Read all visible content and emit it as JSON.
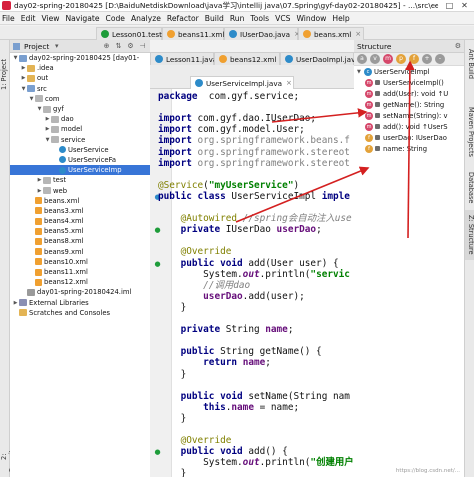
{
  "window": {
    "title": "day02-spring-20180425 [D:\\BaiduNetdiskDownload\\java学习\\intellij java\\07.Spring\\gyf-day02-20180425] - ...\\src\\com\\gyf\\service\\UserServiceImpl.java [day02-spring-20180425] - IntelliJ IDEA",
    "minimize": "—",
    "maximize": "□",
    "close": "✕"
  },
  "menu": [
    "File",
    "Edit",
    "View",
    "Navigate",
    "Code",
    "Analyze",
    "Refactor",
    "Build",
    "Run",
    "Tools",
    "VCS",
    "Window",
    "Help"
  ],
  "project_panel": {
    "label": "Project",
    "tree": [
      {
        "label": "day02-spring-20180425 [day01-",
        "indent": 0,
        "icon": "folder-blue",
        "arrow": "▼"
      },
      {
        "label": ".idea",
        "indent": 1,
        "icon": "folder",
        "arrow": "▶"
      },
      {
        "label": "out",
        "indent": 1,
        "icon": "folder",
        "arrow": "▶"
      },
      {
        "label": "src",
        "indent": 1,
        "icon": "folder-blue",
        "arrow": "▼"
      },
      {
        "label": "com",
        "indent": 2,
        "icon": "package",
        "arrow": "▼"
      },
      {
        "label": "gyf",
        "indent": 3,
        "icon": "package",
        "arrow": "▼"
      },
      {
        "label": "dao",
        "indent": 4,
        "icon": "package",
        "arrow": "▶"
      },
      {
        "label": "model",
        "indent": 4,
        "icon": "package",
        "arrow": "▶"
      },
      {
        "label": "service",
        "indent": 4,
        "icon": "package",
        "arrow": "▼"
      },
      {
        "label": "UserService",
        "indent": 5,
        "icon": "class",
        "arrow": ""
      },
      {
        "label": "UserServiceFa",
        "indent": 5,
        "icon": "class",
        "arrow": ""
      },
      {
        "label": "UserServiceImp",
        "indent": 5,
        "icon": "class",
        "arrow": "",
        "selected": true
      },
      {
        "label": "test",
        "indent": 3,
        "icon": "package",
        "arrow": "▶"
      },
      {
        "label": "web",
        "indent": 3,
        "icon": "package",
        "arrow": "▶"
      },
      {
        "label": "beans.xml",
        "indent": 2,
        "icon": "xml",
        "arrow": ""
      },
      {
        "label": "beans3.xml",
        "indent": 2,
        "icon": "xml",
        "arrow": ""
      },
      {
        "label": "beans4.xml",
        "indent": 2,
        "icon": "xml",
        "arrow": ""
      },
      {
        "label": "beans5.xml",
        "indent": 2,
        "icon": "xml",
        "arrow": ""
      },
      {
        "label": "beans8.xml",
        "indent": 2,
        "icon": "xml",
        "arrow": ""
      },
      {
        "label": "beans9.xml",
        "indent": 2,
        "icon": "xml",
        "arrow": ""
      },
      {
        "label": "beans10.xml",
        "indent": 2,
        "icon": "xml",
        "arrow": ""
      },
      {
        "label": "beans11.xml",
        "indent": 2,
        "icon": "xml",
        "arrow": ""
      },
      {
        "label": "beans12.xml",
        "indent": 2,
        "icon": "xml",
        "arrow": ""
      },
      {
        "label": "day01-spring-20180424.iml",
        "indent": 1,
        "icon": "iml",
        "arrow": ""
      },
      {
        "label": "External Libraries",
        "indent": 0,
        "icon": "lib",
        "arrow": "▶"
      },
      {
        "label": "Scratches and Consoles",
        "indent": 0,
        "icon": "folder",
        "arrow": ""
      }
    ]
  },
  "left_strip": {
    "project_tab": "1: Project",
    "favorites_tab": "2: Favorites"
  },
  "editor_tabs_row1": [
    {
      "label": "Lesson01.test1",
      "active": false
    },
    {
      "label": "beans11.xml",
      "active": false
    },
    {
      "label": "IUserDao.java",
      "active": false
    },
    {
      "label": "beans.xml",
      "active": false
    }
  ],
  "editor_tabs_row2": [
    {
      "label": "Lesson11.java",
      "active": false
    },
    {
      "label": "beans12.xml",
      "active": false
    },
    {
      "label": "UserDaoImpl.java",
      "active": false
    },
    {
      "label": "User.java",
      "active": false
    }
  ],
  "editor_tabs_row3": [
    {
      "label": "UserServiceImpl.java",
      "active": true
    }
  ],
  "code_lines": [
    [
      [
        "kw",
        "package"
      ],
      [
        "",
        "  com.gyf.service;"
      ]
    ],
    [
      [
        "",
        ""
      ]
    ],
    [
      [
        "kw",
        "import"
      ],
      [
        "",
        " com.gyf.dao.IUserDao;"
      ]
    ],
    [
      [
        "kw",
        "import"
      ],
      [
        "",
        " com.gyf.model.User;"
      ]
    ],
    [
      [
        "kw",
        "import"
      ],
      [
        "gray",
        " org.springframework.beans.f"
      ]
    ],
    [
      [
        "kw",
        "import"
      ],
      [
        "gray",
        " org.springframework.stereot"
      ]
    ],
    [
      [
        "kw",
        "import"
      ],
      [
        "gray",
        " org.springframework.stereot"
      ]
    ],
    [
      [
        "",
        ""
      ]
    ],
    [
      [
        "ann",
        "@Service"
      ],
      [
        "",
        "("
      ],
      [
        "str",
        "\"myUserService\""
      ],
      [
        "",
        ")"
      ]
    ],
    [
      [
        "kw",
        "public class"
      ],
      [
        "",
        " UserServiceImpl "
      ],
      [
        "kw",
        "imple"
      ]
    ],
    [
      [
        "",
        ""
      ]
    ],
    [
      [
        "ann",
        "    @Autowired"
      ],
      [
        "cmt",
        " //spring会自动注入use"
      ]
    ],
    [
      [
        "kw",
        "    private"
      ],
      [
        "",
        " IUserDao "
      ],
      [
        "fld",
        "userDao"
      ],
      [
        "",
        ";"
      ]
    ],
    [
      [
        "",
        ""
      ]
    ],
    [
      [
        "ann",
        "    @Override"
      ]
    ],
    [
      [
        "kw",
        "    public void"
      ],
      [
        "",
        " add(User user) {"
      ]
    ],
    [
      [
        "",
        "        System."
      ],
      [
        "static-out",
        "out"
      ],
      [
        "",
        ".println("
      ],
      [
        "str",
        "\"servic"
      ]
    ],
    [
      [
        "cmt",
        "        //调用dao"
      ]
    ],
    [
      [
        "fld",
        "        userDao"
      ],
      [
        "",
        ".add(user);"
      ]
    ],
    [
      [
        "",
        "    }"
      ]
    ],
    [
      [
        "",
        ""
      ]
    ],
    [
      [
        "kw",
        "    private"
      ],
      [
        "",
        " String "
      ],
      [
        "fld",
        "name"
      ],
      [
        "",
        ";"
      ]
    ],
    [
      [
        "",
        ""
      ]
    ],
    [
      [
        "kw",
        "    public"
      ],
      [
        "",
        " String getName() {"
      ]
    ],
    [
      [
        "kw",
        "        return"
      ],
      [
        "",
        " "
      ],
      [
        "fld",
        "name"
      ],
      [
        "",
        ";"
      ]
    ],
    [
      [
        "",
        "    }"
      ]
    ],
    [
      [
        "",
        ""
      ]
    ],
    [
      [
        "kw",
        "    public void"
      ],
      [
        "",
        " setName(String nam"
      ]
    ],
    [
      [
        "kw",
        "        this"
      ],
      [
        "",
        "."
      ],
      [
        "fld",
        "name"
      ],
      [
        "",
        " = "
      ],
      [
        "",
        "name;"
      ]
    ],
    [
      [
        "",
        "    }"
      ]
    ],
    [
      [
        "",
        ""
      ]
    ],
    [
      [
        "ann",
        "    @Override"
      ]
    ],
    [
      [
        "kw",
        "    public void"
      ],
      [
        "",
        " add() {"
      ]
    ],
    [
      [
        "",
        "        System."
      ],
      [
        "static-out",
        "out"
      ],
      [
        "",
        ".println("
      ],
      [
        "str",
        "\"创建用户"
      ]
    ],
    [
      [
        "",
        "    }"
      ]
    ]
  ],
  "structure_panel": {
    "label": "Structure",
    "tree": [
      {
        "label": "UserServiceImpl",
        "indent": 0,
        "icon": "c"
      },
      {
        "label": "UserServiceImpl()",
        "indent": 1,
        "icon": "m"
      },
      {
        "label": "add(User): void ↑U",
        "indent": 1,
        "icon": "m"
      },
      {
        "label": "getName(): String",
        "indent": 1,
        "icon": "m"
      },
      {
        "label": "setName(String): v",
        "indent": 1,
        "icon": "m"
      },
      {
        "label": "add(): void ↑UserS",
        "indent": 1,
        "icon": "m"
      },
      {
        "label": "userDao: IUserDao",
        "indent": 1,
        "icon": "f"
      },
      {
        "label": "name: String",
        "indent": 1,
        "icon": "f"
      }
    ]
  },
  "right_strip": {
    "ant_tab": "Ant Build",
    "maven_tab": "Maven Projects",
    "database_tab": "Database",
    "structure_tab": "Z: Structure"
  },
  "watermark": "https://blog.csdn.net/..."
}
